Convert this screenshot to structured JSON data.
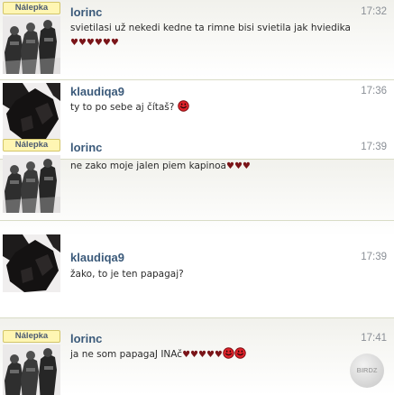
{
  "badge_label": "Nálepka",
  "messages": [
    {
      "author": "lorinc",
      "time": "17:32",
      "has_badge": true,
      "avatar_icon": "soldiers-avatar-icon",
      "text": "svietilasi už nekedi kedne ta rimne bisi svietila jak hviedika",
      "hearts": "♥♥♥♥♥♥",
      "emoji": []
    },
    {
      "author": "klaudiqa9",
      "time": "17:36",
      "has_badge": false,
      "avatar_icon": "dark-portrait-avatar-icon",
      "text": "ty to po sebe aj čítaš?",
      "hearts": "",
      "emoji": [
        "smiley-red-icon"
      ]
    },
    {
      "author": "lorinc",
      "time": "17:39",
      "has_badge": true,
      "avatar_icon": "soldiers-avatar-icon",
      "text": "ne zako moje jalen piem kapinoa",
      "hearts": "♥♥♥",
      "emoji": []
    },
    {
      "author": "klaudiqa9",
      "time": "17:39",
      "has_badge": false,
      "avatar_icon": "dark-portrait-avatar-icon",
      "text": "žako, to je ten papagaj?",
      "hearts": "",
      "emoji": []
    },
    {
      "author": "lorinc",
      "time": "17:41",
      "has_badge": true,
      "avatar_icon": "soldiers-avatar-icon",
      "text": "ja ne som papagaJ INAč",
      "hearts": "♥♥♥♥♥",
      "emoji": [
        "smiley-red-icon",
        "smiley-red-icon"
      ]
    }
  ],
  "watermark": "BIRDZ"
}
